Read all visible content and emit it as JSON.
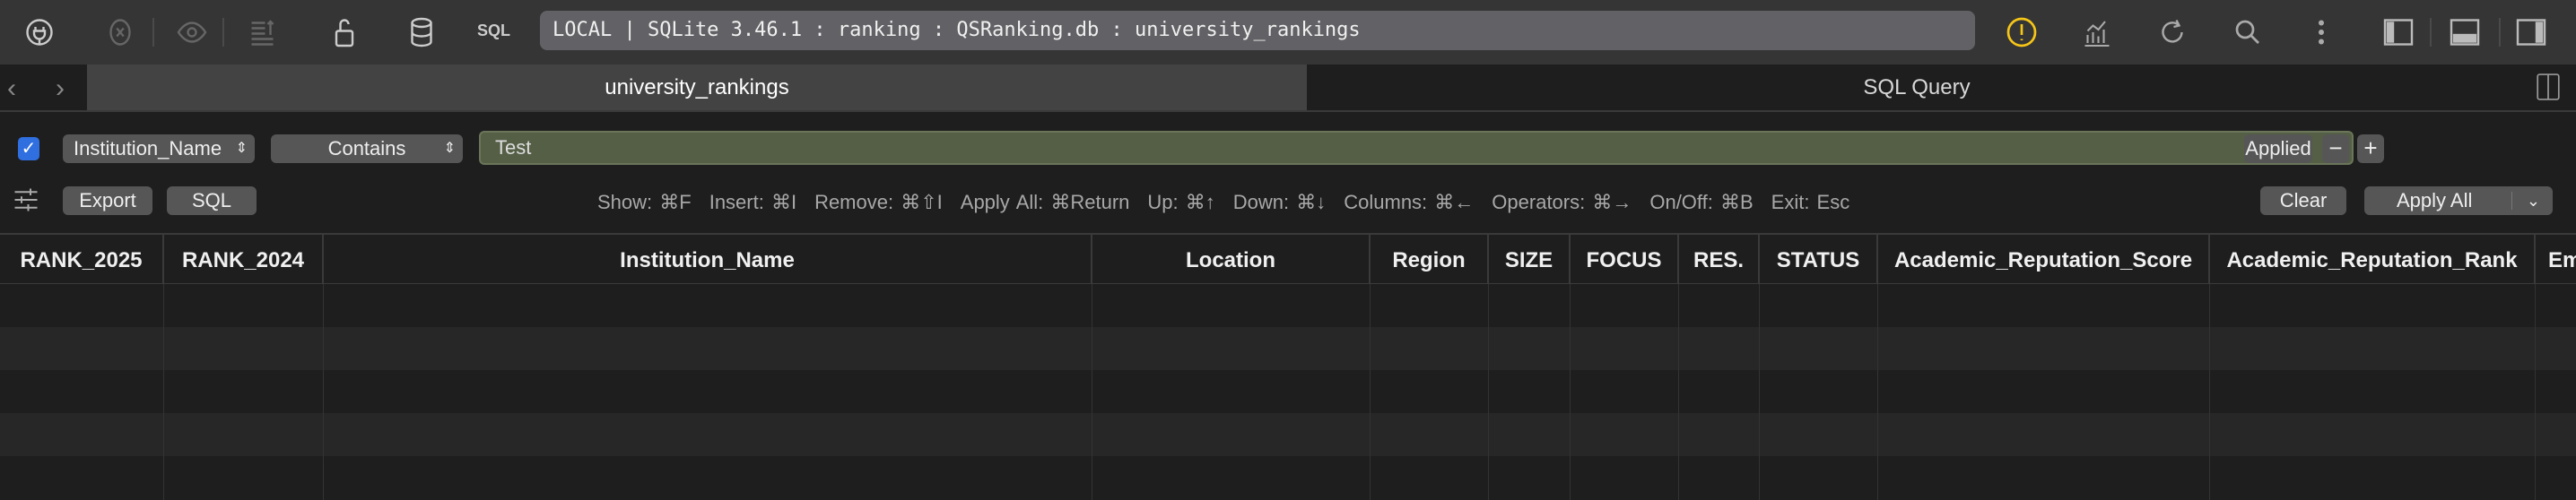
{
  "toolbar": {
    "sql_label": "SQL",
    "address": "LOCAL | SQLite 3.46.1 : ranking : QSRanking.db : university_rankings",
    "warning_color": "#f5c518"
  },
  "tabs": [
    {
      "label": "university_rankings"
    },
    {
      "label": "SQL Query"
    }
  ],
  "filter": {
    "enabled": true,
    "column": "Institution_Name",
    "operator": "Contains",
    "value": "Test",
    "applied_label": "Applied",
    "remove_label": "−",
    "add_label": "+"
  },
  "actions": {
    "export": "Export",
    "sql": "SQL",
    "clear": "Clear",
    "apply_all": "Apply All"
  },
  "shortcuts": [
    "Show: ⌘F",
    "Insert: ⌘I",
    "Remove: ⌘⇧I",
    "Apply All: ⌘Return",
    "Up: ⌘↑",
    "Down: ⌘↓",
    "Columns: ⌘←",
    "Operators: ⌘→",
    "On/Off: ⌘B",
    "Exit: Esc"
  ],
  "columns": [
    "RANK_2025",
    "RANK_2024",
    "Institution_Name",
    "Location",
    "Region",
    "SIZE",
    "FOCUS",
    "RES.",
    "STATUS",
    "Academic_Reputation_Score",
    "Academic_Reputation_Rank",
    "Em"
  ]
}
